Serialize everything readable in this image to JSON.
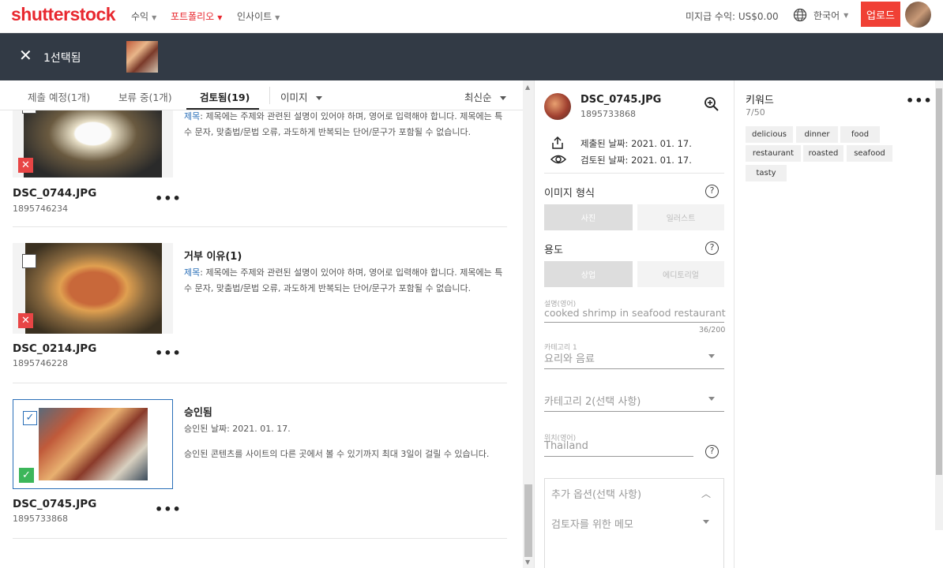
{
  "nav": {
    "logo": "shutterstock",
    "items": [
      {
        "label": "수익"
      },
      {
        "label": "포트폴리오"
      },
      {
        "label": "인사이트"
      }
    ],
    "earnings": "미지급 수익: US$0.00",
    "language": "한국어",
    "upload_label": "업로드",
    "colors": {
      "brand": "#e8282f",
      "upload": "#f04035"
    }
  },
  "selection_bar": {
    "close_glyph": "✕",
    "count_label": "1선택됨"
  },
  "tabs": {
    "items": [
      {
        "label": "제출 예정(1개)"
      },
      {
        "label": "보류 중(1개)"
      },
      {
        "label": "검토됨(19)"
      }
    ],
    "filter_label": "이미지",
    "sort_label": "최신순"
  },
  "list": {
    "items": [
      {
        "filename": "DSC_0744.JPG",
        "id": "1895746234",
        "reason_title": "",
        "reason_label": "제목",
        "reason_text": ": 제목에는 주제와 관련된 설명이 있어야 하며, 영어로 입력해야 합니다. 제목에는 특수 문자, 맞춤법/문법 오류, 과도하게 반복되는 단어/문구가 포함될 수 없습니다."
      },
      {
        "filename": "DSC_0214.JPG",
        "id": "1895746228",
        "reason_title": "거부 이유(1)",
        "reason_label": "제목",
        "reason_text": ": 제목에는 주제와 관련된 설명이 있어야 하며, 영어로 입력해야 합니다. 제목에는 특수 문자, 맞춤법/문법 오류, 과도하게 반복되는 단어/문구가 포함될 수 없습니다."
      },
      {
        "filename": "DSC_0745.JPG",
        "id": "1895733868",
        "status_title": "승인됨",
        "approved_date": "승인된 날짜: 2021. 01. 17.",
        "approved_note": "승인된 콘텐츠를 사이트의 다른 곳에서 볼 수 있기까지 최대 3일이 걸릴 수 있습니다."
      }
    ],
    "more_glyph": "•••",
    "reject_glyph": "✕",
    "approve_glyph": "✓",
    "check_glyph": "✓"
  },
  "detail": {
    "filename": "DSC_0745.JPG",
    "id": "1895733868",
    "submitted": "제출된 날짜: 2021. 01. 17.",
    "reviewed": "검토된 날짜: 2021. 01. 17.",
    "image_type_label": "이미지 형식",
    "image_type_options": [
      "사진",
      "일러스트"
    ],
    "usage_label": "용도",
    "usage_options": [
      "상업",
      "에디토리얼"
    ],
    "description_label": "설명(영어)",
    "description_value": "cooked shrimp in seafood restaurant",
    "description_count": "36/200",
    "category1_label": "카테고리 1",
    "category1_value": "요리와 음료",
    "category2_placeholder": "카테고리 2(선택 사항)",
    "location_label": "위치(영어)",
    "location_value": "Thailand",
    "extra_options_label": "추가 옵션(선택 사항)",
    "reviewer_note_label": "검토자를 위한 메모",
    "help_glyph": "?"
  },
  "keywords": {
    "title": "키워드",
    "count": "7/50",
    "more_glyph": "•••",
    "items": [
      "delicious",
      "dinner",
      "food",
      "restaurant",
      "roasted",
      "seafood",
      "tasty"
    ]
  }
}
